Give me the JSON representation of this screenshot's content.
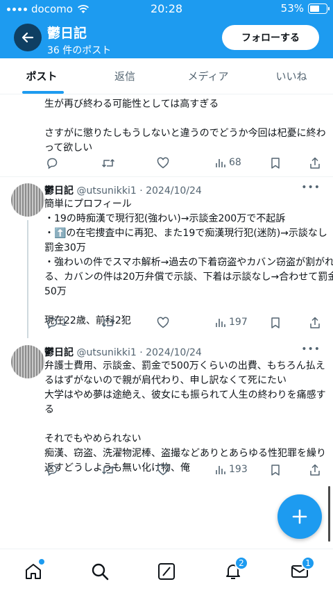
{
  "status_bar": {
    "carrier": "docomo",
    "time": "20:28",
    "battery": "53%"
  },
  "header": {
    "name": "鬱日記",
    "post_count": "36 件のポスト",
    "follow_label": "フォローする"
  },
  "tabs": [
    "ポスト",
    "返信",
    "メディア",
    "いいね"
  ],
  "posts": [
    {
      "lines": [
        "生が再び終わる可能性としては高すぎる",
        "",
        "さすがに懲りたしもうしないと違うのでどうか今回は杞憂に終わ",
        "って欲しい"
      ],
      "views": "68"
    },
    {
      "name": "鬱日記",
      "handle": "@utsunikki1 · 2024/10/24",
      "lines": [
        "簡単にプロフィール",
        "・19の時痴漢で現行犯(強わい)→示談金200万で不起訴",
        "・⬆️の在宅捜査中に再犯、また19で痴漢現行犯(迷防)→示談なし",
        "罰金30万",
        "・強わいの件でスマホ解析→過去の下着窃盗やカバン窃盗が割がれ",
        "る、カバンの件は20万弁償で示談、下着は示談なし→合わせて罰金",
        "50万",
        "",
        "現在22歳、前科2犯"
      ],
      "replies": "1",
      "views": "197"
    },
    {
      "name": "鬱日記",
      "handle": "@utsunikki1 · 2024/10/24",
      "lines": [
        "弁護士費用、示談金、罰金で500万くらいの出費、もちろん払え",
        "るはずがないので親が肩代わり、申し訳なくて死にたい",
        "大学はやめ夢は途絶え、彼女にも振られて人生の終わりを痛感す",
        "る",
        "",
        "それでもやめられない",
        "痴漢、窃盗、洗濯物泥棒、盗撮などありとあらゆる性犯罪を繰り",
        "返すどうしようも無い化け物、俺"
      ],
      "views": "193"
    }
  ],
  "bottom_nav": {
    "notifications_badge": "2",
    "messages_badge": "1"
  }
}
